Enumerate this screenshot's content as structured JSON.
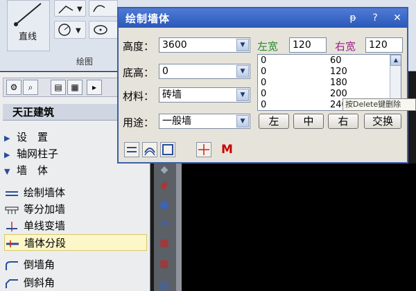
{
  "ribbon": {
    "line_tool_label": "直线",
    "group_label": "绘图"
  },
  "palette": {
    "title": "天正建筑",
    "tree": [
      {
        "label": "设　置",
        "arrow": "▶"
      },
      {
        "label": "轴网柱子",
        "arrow": "▶"
      },
      {
        "label": "墙　体",
        "arrow": "▼"
      }
    ],
    "commands": [
      {
        "label": "绘制墙体",
        "icon": "draw-wall-icon"
      },
      {
        "label": "等分加墙",
        "icon": "divide-wall-icon"
      },
      {
        "label": "单线变墙",
        "icon": "line-to-wall-icon"
      },
      {
        "label": "墙体分段",
        "icon": "split-wall-icon"
      },
      {
        "label": "倒墙角",
        "icon": "fillet-wall-icon"
      },
      {
        "label": "倒斜角",
        "icon": "chamfer-wall-icon"
      }
    ]
  },
  "dialog": {
    "title": "绘制墙体",
    "title_buttons": {
      "pin": "ᵽ",
      "help": "?",
      "close": "✕"
    },
    "height_label": "高度：",
    "height_value": "3600",
    "base_label": "底高：",
    "base_value": "0",
    "material_label": "材料：",
    "material_value": "砖墙",
    "usage_label": "用途：",
    "usage_value": "一般墙",
    "left_width_label": "左宽",
    "left_width_value": "120",
    "right_width_label": "右宽",
    "right_width_value": "120",
    "width_list": [
      {
        "left": "0",
        "right": "60"
      },
      {
        "left": "0",
        "right": "120"
      },
      {
        "left": "0",
        "right": "180"
      },
      {
        "left": "0",
        "right": "200"
      },
      {
        "left": "0",
        "right": "240"
      }
    ],
    "buttons": {
      "left": "左",
      "center": "中",
      "right": "右",
      "swap": "交换"
    },
    "bottom_m_label": "M",
    "tooltip": "按Delete键删除"
  },
  "colors": {
    "titlebar": "#2a58b8",
    "left_width_label": "#2a8a2a",
    "right_width_label": "#9a1f8a",
    "m_label": "#cc0000",
    "highlight_row": "#fdf6c8"
  }
}
